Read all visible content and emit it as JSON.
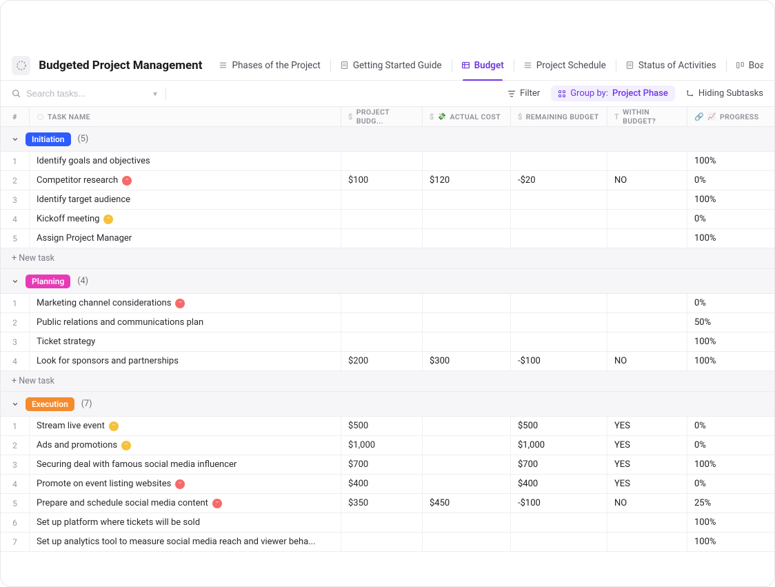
{
  "project": {
    "title": "Budgeted Project Management"
  },
  "tabs": [
    {
      "id": "phases",
      "label": "Phases of the Project",
      "active": false,
      "icon": "list"
    },
    {
      "id": "guide",
      "label": "Getting Started Guide",
      "active": false,
      "icon": "doc"
    },
    {
      "id": "budget",
      "label": "Budget",
      "active": true,
      "icon": "table"
    },
    {
      "id": "schedule",
      "label": "Project Schedule",
      "active": false,
      "icon": "list"
    },
    {
      "id": "status",
      "label": "Status of Activities",
      "active": false,
      "icon": "doc"
    },
    {
      "id": "board",
      "label": "Board",
      "active": false,
      "icon": "board"
    }
  ],
  "toolbar": {
    "search_placeholder": "Search tasks...",
    "filter_label": "Filter",
    "groupby_label": "Group by:",
    "groupby_value": "Project Phase",
    "hiding_label": "Hiding Subtasks"
  },
  "columns": {
    "num": "#",
    "task": "TASK NAME",
    "budget": "PROJECT BUDG...",
    "actual": "ACTUAL COST",
    "remain": "REMAINING BUDGET",
    "within": "WITHIN BUDGET?",
    "progress": "PROGRESS"
  },
  "new_task_label": "+ New task",
  "status_colors": {
    "red": "#f76a6a",
    "yellow": "#f5c23a"
  },
  "phase_colors": {
    "Initiation": "#2e5bff",
    "Planning": "#e83ab6",
    "Execution": "#f58b2e"
  },
  "groups": [
    {
      "phase": "Initiation",
      "count": "(5)",
      "tasks": [
        {
          "n": "1",
          "name": "Identify goals and objectives",
          "status": null,
          "budget": "",
          "actual": "",
          "remain": "",
          "within": "",
          "progress": "100%"
        },
        {
          "n": "2",
          "name": "Competitor research",
          "status": "red",
          "budget": "$100",
          "actual": "$120",
          "remain": "-$20",
          "within": "NO",
          "progress": "0%"
        },
        {
          "n": "3",
          "name": "Identify target audience",
          "status": null,
          "budget": "",
          "actual": "",
          "remain": "",
          "within": "",
          "progress": "100%"
        },
        {
          "n": "4",
          "name": "Kickoff meeting",
          "status": "yellow",
          "budget": "",
          "actual": "",
          "remain": "",
          "within": "",
          "progress": "0%"
        },
        {
          "n": "5",
          "name": "Assign Project Manager",
          "status": null,
          "budget": "",
          "actual": "",
          "remain": "",
          "within": "",
          "progress": "100%"
        }
      ]
    },
    {
      "phase": "Planning",
      "count": "(4)",
      "tasks": [
        {
          "n": "1",
          "name": "Marketing channel considerations",
          "status": "red",
          "budget": "",
          "actual": "",
          "remain": "",
          "within": "",
          "progress": "0%"
        },
        {
          "n": "2",
          "name": "Public relations and communications plan",
          "status": null,
          "budget": "",
          "actual": "",
          "remain": "",
          "within": "",
          "progress": "50%"
        },
        {
          "n": "3",
          "name": "Ticket strategy",
          "status": null,
          "budget": "",
          "actual": "",
          "remain": "",
          "within": "",
          "progress": "100%"
        },
        {
          "n": "4",
          "name": "Look for sponsors and partnerships",
          "status": null,
          "budget": "$200",
          "actual": "$300",
          "remain": "-$100",
          "within": "NO",
          "progress": "100%"
        }
      ]
    },
    {
      "phase": "Execution",
      "count": "(7)",
      "tasks": [
        {
          "n": "1",
          "name": "Stream live event",
          "status": "yellow",
          "budget": "$500",
          "actual": "",
          "remain": "$500",
          "within": "YES",
          "progress": "0%"
        },
        {
          "n": "2",
          "name": "Ads and promotions",
          "status": "yellow",
          "budget": "$1,000",
          "actual": "",
          "remain": "$1,000",
          "within": "YES",
          "progress": "0%"
        },
        {
          "n": "3",
          "name": "Securing deal with famous social media influencer",
          "status": null,
          "budget": "$700",
          "actual": "",
          "remain": "$700",
          "within": "YES",
          "progress": "100%"
        },
        {
          "n": "4",
          "name": "Promote on event listing websites",
          "status": "red",
          "budget": "$400",
          "actual": "",
          "remain": "$400",
          "within": "YES",
          "progress": "0%"
        },
        {
          "n": "5",
          "name": "Prepare and schedule social media content",
          "status": "red",
          "budget": "$350",
          "actual": "$450",
          "remain": "-$100",
          "within": "NO",
          "progress": "25%"
        },
        {
          "n": "6",
          "name": "Set up platform where tickets will be sold",
          "status": null,
          "budget": "",
          "actual": "",
          "remain": "",
          "within": "",
          "progress": "100%"
        },
        {
          "n": "7",
          "name": "Set up analytics tool to measure social media reach and viewer beha...",
          "status": null,
          "budget": "",
          "actual": "",
          "remain": "",
          "within": "",
          "progress": "100%"
        }
      ]
    }
  ]
}
